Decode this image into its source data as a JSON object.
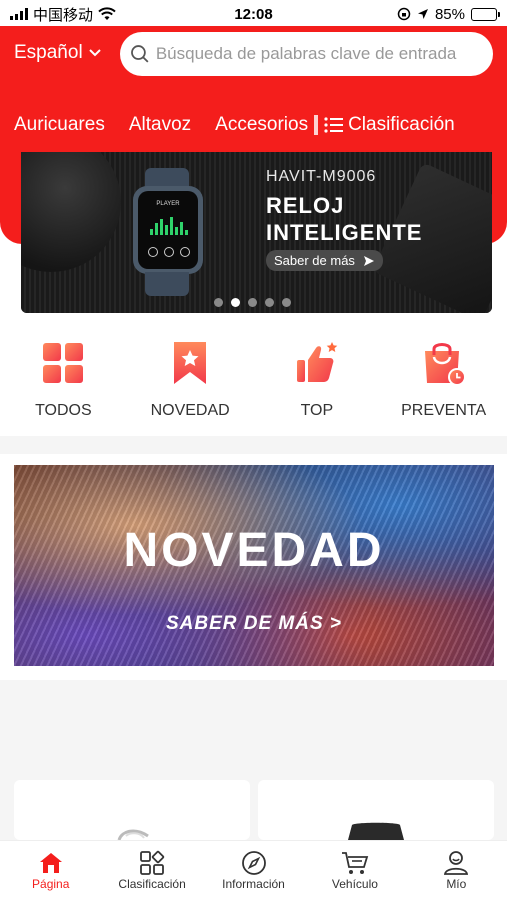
{
  "status_bar": {
    "carrier": "中国移动",
    "time": "12:08",
    "battery": "85%",
    "battery_level": 0.85
  },
  "header": {
    "language": "Español",
    "search_placeholder": "Búsqueda de palabras clave de entrada",
    "categories": [
      "Auricuares",
      "Altavoz",
      "Accesorios"
    ],
    "classification": "Clasificación"
  },
  "banner": {
    "model": "HAVIT-M9006",
    "title_line1": "RELOJ",
    "title_line2": "INTELIGENTE",
    "cta": "Saber de más",
    "watch_label": "PLAYER",
    "dots_count": 5,
    "active_dot": 1
  },
  "quick_links": [
    {
      "label": "TODOS",
      "icon": "grid-icon"
    },
    {
      "label": "NOVEDAD",
      "icon": "bookmark-star-icon"
    },
    {
      "label": "TOP",
      "icon": "thumbs-up-icon"
    },
    {
      "label": "PREVENTA",
      "icon": "shopping-bag-clock-icon"
    }
  ],
  "novedad_banner": {
    "title": "NOVEDAD",
    "cta": "SABER DE MÁS >"
  },
  "bottom_nav": [
    {
      "label": "Página",
      "icon": "home-icon",
      "active": true
    },
    {
      "label": "Clasificación",
      "icon": "categories-icon",
      "active": false
    },
    {
      "label": "Información",
      "icon": "compass-icon",
      "active": false
    },
    {
      "label": "Vehículo",
      "icon": "cart-icon",
      "active": false
    },
    {
      "label": "Mío",
      "icon": "user-icon",
      "active": false
    }
  ],
  "colors": {
    "accent": "#f41e1c",
    "icon_gradient_start": "#ff8a5c",
    "icon_gradient_end": "#f2394a"
  }
}
